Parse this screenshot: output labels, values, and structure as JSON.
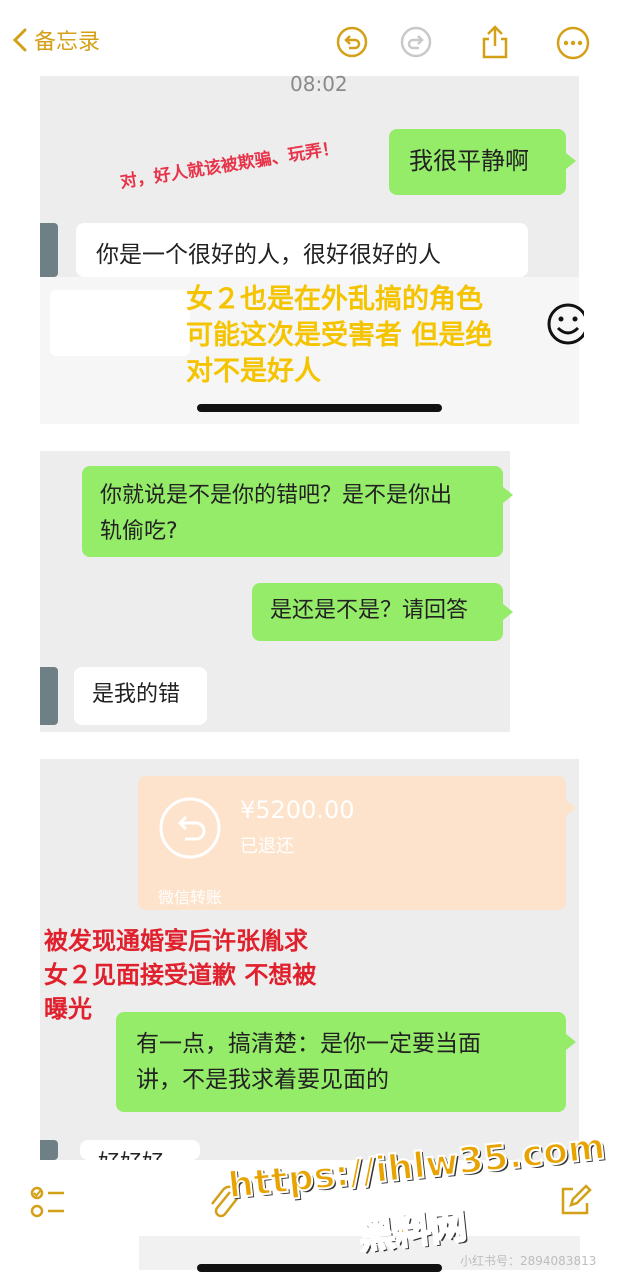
{
  "header": {
    "back_label": "备忘录"
  },
  "shot1": {
    "time": "08:02",
    "stamp_text": "对，好人就该被欺骗、玩弄！",
    "msg_right": "我很平静啊",
    "msg_left": "你是一个很好的人，很好很好的人",
    "overlay": [
      "女２也是在外乱搞的角色",
      "可能这次是受害者 但是绝",
      "对不是好人"
    ]
  },
  "shot2": {
    "msg1_line1": "你就说是不是你的错吧？是不是你出",
    "msg1_line2": "轨偷吃?",
    "msg2": "是还是不是？请回答",
    "msg3": "是我的错"
  },
  "shot3": {
    "transfer_amount": "¥5200.00",
    "transfer_status": "已退还",
    "transfer_footer": "微信转账",
    "overlay": [
      "被发现通婚宴后许张胤求",
      "女２见面接受道歉 不想被",
      "曝光"
    ],
    "msg_line1": "有一点，搞清楚：是你一定要当面",
    "msg_line2": "讲，不是我求着要见面的",
    "partial_msg": "好好好"
  },
  "footer": {
    "watermark_line1": "https://ihlw35.com",
    "watermark_line2": "黑料网",
    "small_id": "小红书号：2894083813"
  },
  "colors": {
    "accent": "#d4a017",
    "wechat_green": "#95ec69",
    "overlay_yellow": "#f5c400",
    "overlay_red": "#e0202c"
  }
}
